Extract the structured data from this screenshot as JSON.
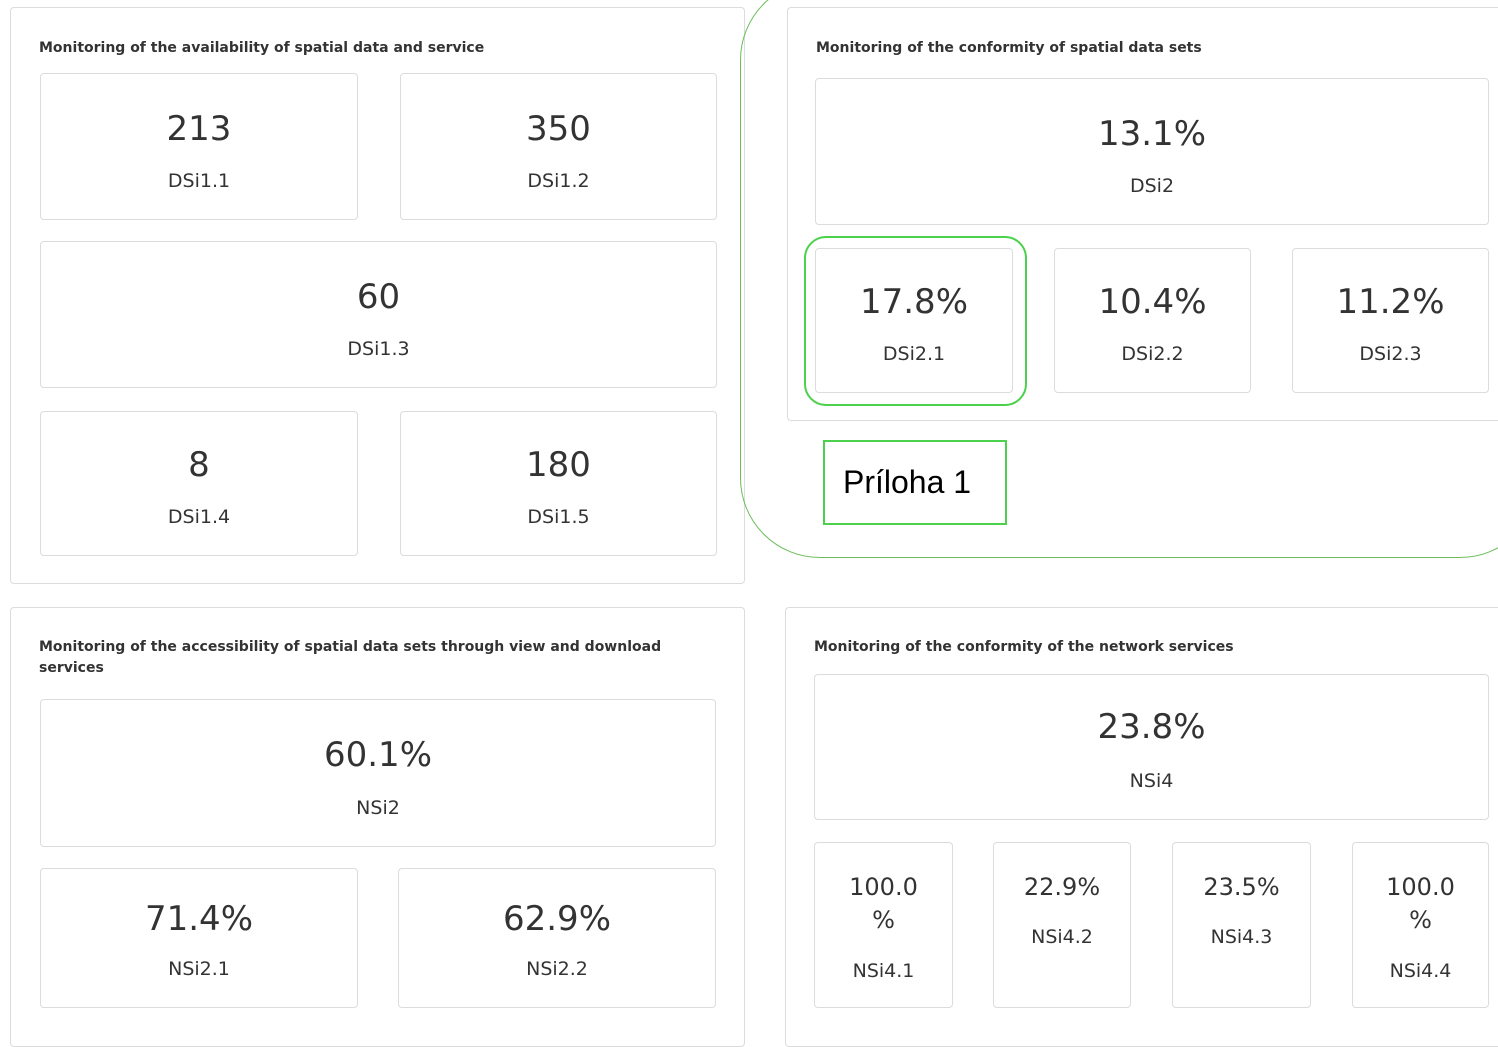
{
  "panels": {
    "availability": {
      "title": "Monitoring of the availability of spatial data and service",
      "cards": [
        {
          "value": "213",
          "label": "DSi1.1"
        },
        {
          "value": "350",
          "label": "DSi1.2"
        },
        {
          "value": "60",
          "label": "DSi1.3"
        },
        {
          "value": "8",
          "label": "DSi1.4"
        },
        {
          "value": "180",
          "label": "DSi1.5"
        }
      ]
    },
    "conformity_datasets": {
      "title": "Monitoring of the conformity of spatial data sets",
      "cards": [
        {
          "value": "13.1%",
          "label": "DSi2"
        },
        {
          "value": "17.8%",
          "label": "DSi2.1"
        },
        {
          "value": "10.4%",
          "label": "DSi2.2"
        },
        {
          "value": "11.2%",
          "label": "DSi2.3"
        }
      ]
    },
    "accessibility": {
      "title": "Monitoring of the accessibility of spatial data sets through view and download services",
      "cards": [
        {
          "value": "60.1%",
          "label": "NSi2"
        },
        {
          "value": "71.4%",
          "label": "NSi2.1"
        },
        {
          "value": "62.9%",
          "label": "NSi2.2"
        }
      ]
    },
    "conformity_services": {
      "title": "Monitoring of the conformity of the network services",
      "cards": [
        {
          "value": "23.8%",
          "label": "NSi4"
        },
        {
          "value_line1": "100.0",
          "value_line2": "%",
          "label": "NSi4.1"
        },
        {
          "value": "22.9%",
          "label": "NSi4.2"
        },
        {
          "value": "23.5%",
          "label": "NSi4.3"
        },
        {
          "value_line1": "100.0",
          "value_line2": "%",
          "label": "NSi4.4"
        }
      ]
    }
  },
  "annotation": {
    "label": "Príloha 1"
  },
  "colors": {
    "highlight": "#4cd14c",
    "highlight_outline": "#6abd5a",
    "border": "#dcdcdc",
    "text": "#333333"
  }
}
